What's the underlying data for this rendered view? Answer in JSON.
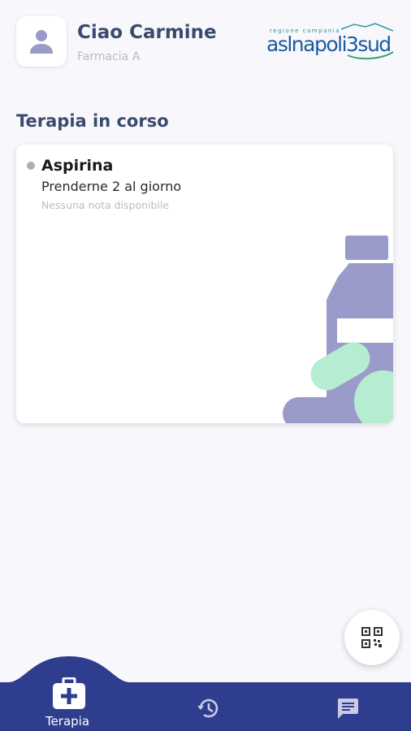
{
  "header": {
    "greeting": "Ciao Carmine",
    "pharmacy": "Farmacia A",
    "logo": {
      "small_text": "regione campania",
      "main_text": "aslnapoli3sud"
    }
  },
  "section": {
    "title": "Terapia in corso"
  },
  "therapy": {
    "name": "Aspirina",
    "dosage": "Prenderne 2 al giorno",
    "note": "Nessuna nota disponibile"
  },
  "nav": {
    "items": [
      {
        "label": "Terapia",
        "icon": "medical-kit-icon",
        "active": true
      },
      {
        "label": "",
        "icon": "history-icon",
        "active": false
      },
      {
        "label": "",
        "icon": "chat-icon",
        "active": false
      }
    ]
  },
  "colors": {
    "nav_bg": "#2f3d8f",
    "title": "#3a4a6e",
    "illustration_purple": "#9a9bcb",
    "illustration_green": "#b6ecd0"
  }
}
